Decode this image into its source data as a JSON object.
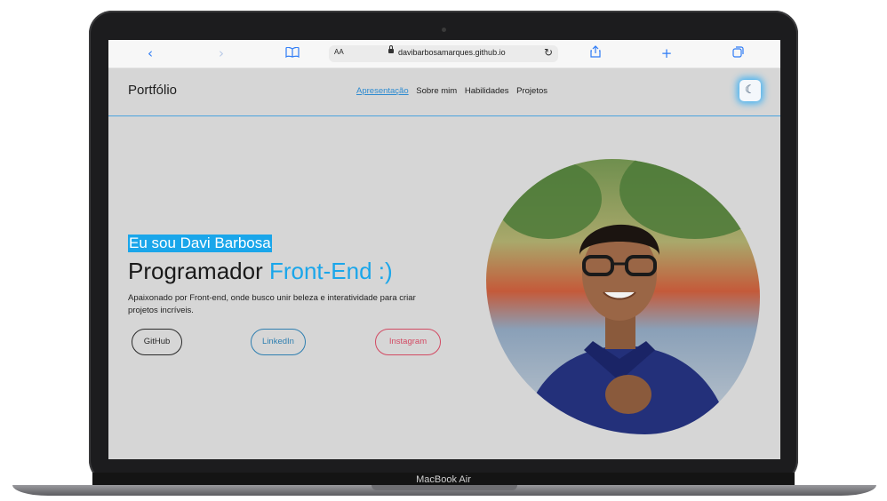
{
  "browser": {
    "url": "davibarbosamarques.github.io",
    "reader_label": "AA"
  },
  "site": {
    "logo": "Portfólio",
    "nav": [
      "Apresentação",
      "Sobre mim",
      "Habilidades",
      "Projetos"
    ],
    "active_nav": "Apresentação",
    "theme_icon": "moon-icon"
  },
  "hero": {
    "greeting": "Eu sou Davi Barbosa",
    "title_prefix": "Programador",
    "title_highlight": "Front-End :)",
    "bio": "Apaixonado por Front-end, onde busco unir beleza e interatividade para criar projetos incríveis.",
    "buttons": {
      "github": "GitHub",
      "linkedin": "LinkedIn",
      "instagram": "Instagram"
    }
  },
  "device_label": "MacBook Air",
  "colors": {
    "accent": "#1aa6ea",
    "page_bg": "#d6d6d6",
    "linkedin": "#2f7fb0",
    "instagram": "#d24a63"
  }
}
